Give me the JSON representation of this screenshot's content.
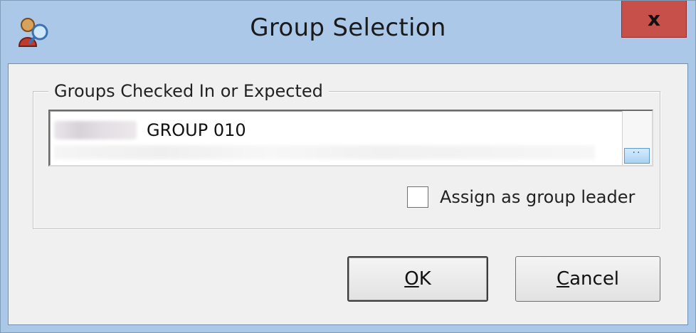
{
  "window": {
    "title": "Group Selection",
    "app_icon": "person-magnifier-icon",
    "close_label": "x"
  },
  "groups": {
    "legend": "Groups Checked In or Expected",
    "items": [
      {
        "name": "GROUP 010"
      }
    ]
  },
  "options": {
    "assign_leader_label": "Assign as group leader",
    "assign_leader_checked": false
  },
  "buttons": {
    "ok_mnemonic": "O",
    "ok_rest": "K",
    "cancel_mnemonic": "C",
    "cancel_rest": "ancel"
  },
  "colors": {
    "frame": "#abc8e9",
    "close": "#c7504a",
    "client": "#f0f0f0"
  }
}
